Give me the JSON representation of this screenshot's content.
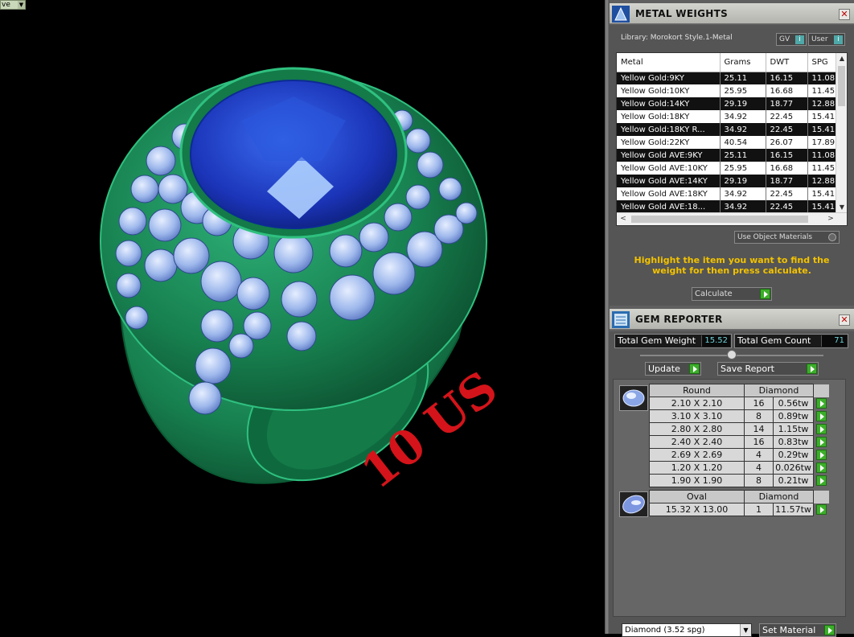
{
  "viewport": {
    "view_dropdown_label": "ve",
    "ring_size_label": "10 US"
  },
  "metal_weights": {
    "title": "METAL WEIGHTS",
    "library_label": "Library: Morokort Style.1-Metal",
    "toggle_gv": "GV",
    "toggle_user": "User",
    "columns": [
      "Metal",
      "Grams",
      "DWT",
      "SPG"
    ],
    "rows": [
      [
        "Yellow Gold:9KY",
        "25.11",
        "16.15",
        "11.08"
      ],
      [
        "Yellow Gold:10KY",
        "25.95",
        "16.68",
        "11.45"
      ],
      [
        "Yellow Gold:14KY",
        "29.19",
        "18.77",
        "12.88"
      ],
      [
        "Yellow Gold:18KY",
        "34.92",
        "22.45",
        "15.41"
      ],
      [
        "Yellow Gold:18KY R...",
        "34.92",
        "22.45",
        "15.41"
      ],
      [
        "Yellow Gold:22KY",
        "40.54",
        "26.07",
        "17.89"
      ],
      [
        "Yellow Gold AVE:9KY",
        "25.11",
        "16.15",
        "11.08"
      ],
      [
        "Yellow Gold AVE:10KY",
        "25.95",
        "16.68",
        "11.45"
      ],
      [
        "Yellow Gold AVE:14KY",
        "29.19",
        "18.77",
        "12.88"
      ],
      [
        "Yellow Gold AVE:18KY",
        "34.92",
        "22.45",
        "15.41"
      ],
      [
        "Yellow Gold AVE:18...",
        "34.92",
        "22.45",
        "15.41"
      ]
    ],
    "use_object_materials": "Use Object Materials",
    "instruction": "Highlight the item you want to find the weight for then press calculate.",
    "calculate_label": "Calculate"
  },
  "gem_reporter": {
    "title": "GEM REPORTER",
    "total_weight_label": "Total Gem Weight",
    "total_weight_value": "15.52",
    "total_count_label": "Total Gem Count",
    "total_count_value": "71",
    "update_label": "Update",
    "save_report_label": "Save Report",
    "groups": [
      {
        "shape": "Round",
        "material": "Diamond",
        "rows": [
          [
            "2.10 X 2.10",
            "16",
            "0.56tw"
          ],
          [
            "3.10 X 3.10",
            "8",
            "0.89tw"
          ],
          [
            "2.80 X 2.80",
            "14",
            "1.15tw"
          ],
          [
            "2.40 X 2.40",
            "16",
            "0.83tw"
          ],
          [
            "2.69 X 2.69",
            "4",
            "0.29tw"
          ],
          [
            "1.20 X 1.20",
            "4",
            "0.026tw"
          ],
          [
            "1.90 X 1.90",
            "8",
            "0.21tw"
          ]
        ]
      },
      {
        "shape": "Oval",
        "material": "Diamond",
        "rows": [
          [
            "15.32 X 13.00",
            "1",
            "11.57tw"
          ]
        ]
      }
    ],
    "material_select": "Diamond      (3.52 spg)",
    "set_material_label": "Set Material"
  },
  "colors": {
    "ring_metal": "#1e8a5a",
    "center_stone": "#1f3fbf",
    "side_stones": "#a9c4f2",
    "size_text": "#d4141a",
    "instruction_text": "#f2c200",
    "go_button": "#3cae2a"
  }
}
